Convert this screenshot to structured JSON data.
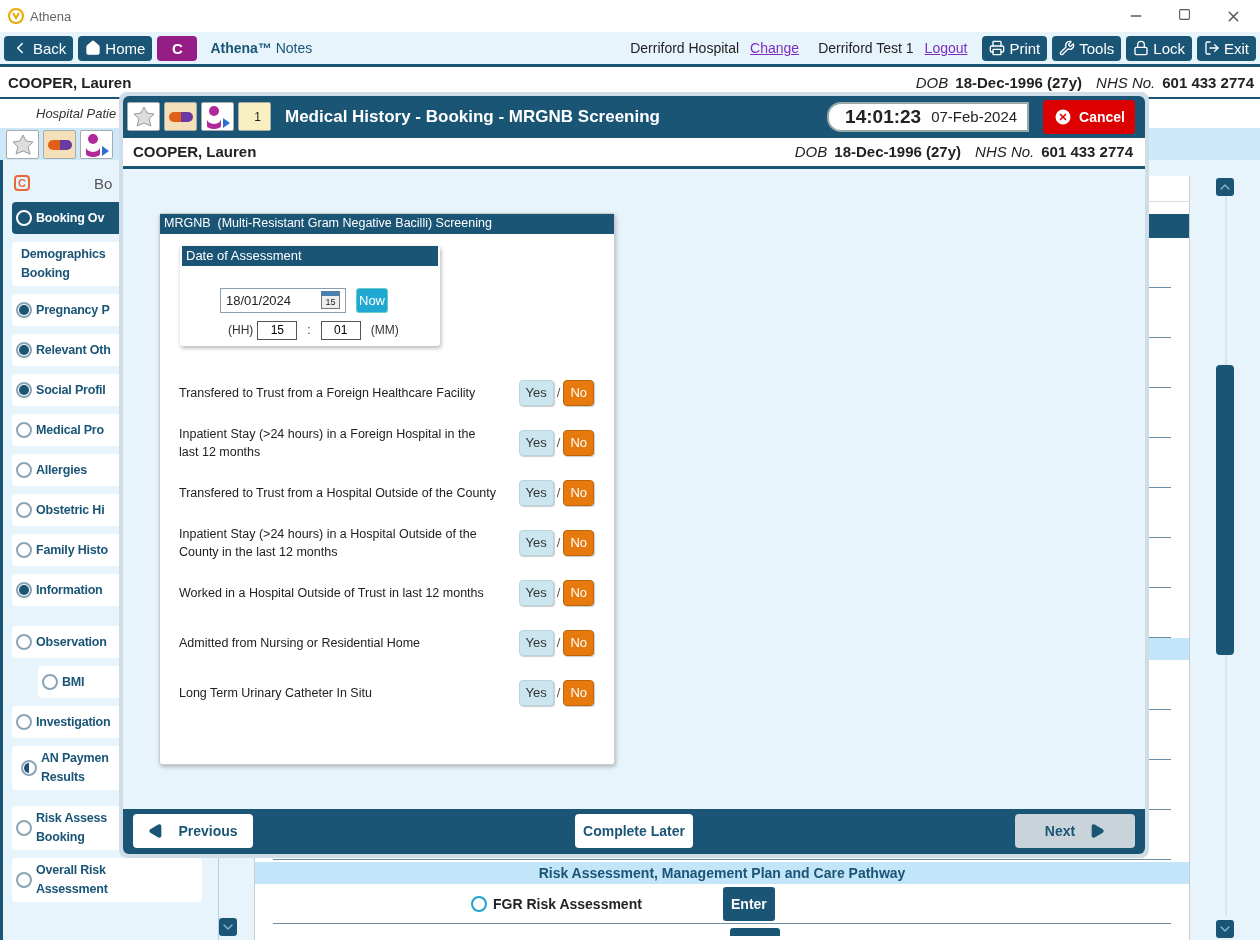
{
  "window": {
    "title": "Athena"
  },
  "toolbar": {
    "left_buttons": [
      {
        "label": "Back",
        "kind": "back"
      },
      {
        "label": "Home",
        "kind": "home"
      },
      {
        "label": "C",
        "kind": "letter"
      }
    ],
    "app_name": "**Athena™** Notes",
    "location": "Derriford Hospital",
    "location_link": "Change",
    "user": "Derriford Test 1",
    "user_link": "Logout",
    "right_buttons": [
      {
        "label": "Print",
        "kind": "print"
      },
      {
        "label": "Tools",
        "kind": "tools"
      },
      {
        "label": "Lock",
        "kind": "lock"
      },
      {
        "label": "Exit",
        "kind": "exit"
      }
    ]
  },
  "patient": {
    "name": "COOPER, Lauren",
    "dob_label": "DOB",
    "dob": "18-Dec-1996 (27y)",
    "nhs_label": "NHS No.",
    "nhs": "601 433 2774"
  },
  "subheader": "Hospital Patie",
  "sidebar": {
    "icon_letter": "C",
    "title": "Bo",
    "groups": [
      [
        {
          "label": "Booking Ov",
          "kind": "radio",
          "checked": false,
          "selected": true
        },
        {
          "label": "Demographics Booking",
          "kind": "plain",
          "selected": false
        },
        {
          "label": "Pregnancy P",
          "kind": "radio",
          "checked": true,
          "selected": false
        },
        {
          "label": "Relevant Oth",
          "kind": "radio",
          "checked": true,
          "selected": false
        },
        {
          "label": "Social Profil",
          "kind": "radio",
          "checked": true,
          "selected": false
        },
        {
          "label": "Medical Pro",
          "kind": "radio",
          "checked": false,
          "selected": false
        },
        {
          "label": "Allergies",
          "kind": "radio",
          "checked": false,
          "selected": false
        },
        {
          "label": "Obstetric Hi",
          "kind": "radio",
          "checked": false,
          "selected": false
        },
        {
          "label": "Family Histo",
          "kind": "radio",
          "checked": false,
          "selected": false
        },
        {
          "label": "Information",
          "kind": "radio",
          "checked": true,
          "selected": false
        }
      ],
      [
        {
          "label": "Observation",
          "kind": "radio",
          "checked": false,
          "selected": false,
          "children": [
            {
              "label": "BMI",
              "kind": "radio",
              "checked": false,
              "selected": false
            }
          ]
        },
        {
          "label": "Investigation",
          "kind": "radio",
          "checked": false,
          "selected": false
        },
        {
          "label": "AN Paymen Results",
          "kind": "half-radio",
          "selected": false
        }
      ],
      [
        {
          "label": "Risk Assess Booking",
          "kind": "radio",
          "checked": false,
          "selected": false
        },
        {
          "label": "Overall Risk Assessment",
          "kind": "radio",
          "checked": false,
          "selected": false
        }
      ]
    ]
  },
  "main": {
    "band": "Risk Assessment, Management Plan and Care Pathway",
    "rows": [
      {
        "label": "FGR Risk Assessment",
        "button": "Enter"
      }
    ]
  },
  "modal": {
    "title": "Medical History - Booking - MRGNB Screening",
    "calendar_day": "1",
    "time": "14:01:23",
    "date": "07-Feb-2024",
    "cancel": "Cancel",
    "patient": {
      "name": "COOPER, Lauren",
      "dob_label": "DOB",
      "dob": "18-Dec-1996 (27y)",
      "nhs_label": "NHS No.",
      "nhs": "601 433 2774"
    },
    "section_title": "MRGNB  (Multi-Resistant Gram Negative Bacilli) Screening",
    "assessment": {
      "title": "Date of Assessment",
      "date": "18/01/2024",
      "calendar_day": "15",
      "now": "Now",
      "hh_label": "(HH)",
      "hh": "15",
      "separator": ":",
      "mm": "01",
      "mm_label": "(MM)"
    },
    "questions": [
      {
        "text": "Transfered to Trust from a Foreign Healthcare Facility",
        "separator": "/",
        "options": [
          {
            "label": "Yes",
            "selected": false
          },
          {
            "label": "No",
            "selected": true
          }
        ]
      },
      {
        "text": "Inpatient Stay (>24 hours) in a Foreign Hospital in the last 12 months",
        "separator": "/",
        "options": [
          {
            "label": "Yes",
            "selected": false
          },
          {
            "label": "No",
            "selected": true
          }
        ]
      },
      {
        "text": "Transfered to Trust from a Hospital Outside of the County",
        "separator": "/",
        "options": [
          {
            "label": "Yes",
            "selected": false
          },
          {
            "label": "No",
            "selected": true
          }
        ]
      },
      {
        "text": "Inpatient Stay (>24 hours) in a Hospital Outside of the County in the last 12 months",
        "separator": "/",
        "options": [
          {
            "label": "Yes",
            "selected": false
          },
          {
            "label": "No",
            "selected": true
          }
        ]
      },
      {
        "text": "Worked in a Hospital Outside of Trust in last 12 months",
        "separator": "/",
        "options": [
          {
            "label": "Yes",
            "selected": false
          },
          {
            "label": "No",
            "selected": true
          }
        ]
      },
      {
        "text": "Admitted from Nursing or Residential Home",
        "separator": "/",
        "options": [
          {
            "label": "Yes",
            "selected": false
          },
          {
            "label": "No",
            "selected": true
          }
        ]
      },
      {
        "text": "Long Term Urinary Catheter In Situ",
        "separator": "/",
        "options": [
          {
            "label": "Yes",
            "selected": false
          },
          {
            "label": "No",
            "selected": true
          }
        ]
      }
    ],
    "footer": {
      "previous": "Previous",
      "complete_later": "Complete Later",
      "next": "Next",
      "next_disabled": true
    }
  }
}
